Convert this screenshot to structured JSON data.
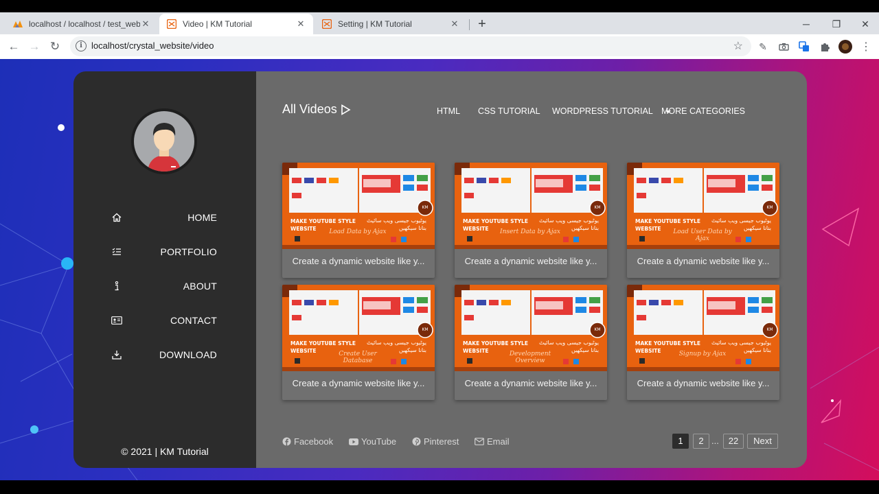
{
  "browser": {
    "tabs": [
      {
        "title": "localhost / localhost / test_web /",
        "active": false
      },
      {
        "title": "Video | KM Tutorial",
        "active": true
      },
      {
        "title": "Setting | KM Tutorial",
        "active": false
      }
    ],
    "url": "localhost/crystal_website/video",
    "new_tab_icon": "plus-icon"
  },
  "sidebar": {
    "menu": [
      {
        "label": "HOME",
        "icon": "home-icon"
      },
      {
        "label": "PORTFOLIO",
        "icon": "list-icon"
      },
      {
        "label": "ABOUT",
        "icon": "info-icon"
      },
      {
        "label": "CONTACT",
        "icon": "contact-card-icon"
      },
      {
        "label": "DOWNLOAD",
        "icon": "download-icon"
      }
    ],
    "copyright": "© 2021 | KM Tutorial"
  },
  "content": {
    "heading": "All Videos",
    "categories": [
      "HTML",
      "CSS TUTORIAL",
      "WORDPRESS TUTORIAL",
      "MORE CATEGORIES"
    ],
    "videos": [
      {
        "title": "Create a dynamic website like y...",
        "thumb_caption": "Load Data by Ajax"
      },
      {
        "title": "Create a dynamic website like y...",
        "thumb_caption": "Insert Data by Ajax"
      },
      {
        "title": "Create a dynamic website like y...",
        "thumb_caption": "Load User Data by Ajax"
      },
      {
        "title": "Create a dynamic website like y...",
        "thumb_caption": "Create User Database"
      },
      {
        "title": "Create a dynamic website like y...",
        "thumb_caption": "Development Overview"
      },
      {
        "title": "Create a dynamic website like y...",
        "thumb_caption": "Signup by Ajax"
      }
    ],
    "thumb_text": {
      "headline_1": "MAKE YOUTUBE STYLE",
      "headline_2": "WEBSITE",
      "urdu_1": "یوٹیوب جیسی ویب سائیٹ",
      "urdu_2": "بنانا سیکھیں",
      "badge": "KM"
    },
    "social": [
      {
        "label": "Facebook",
        "icon": "facebook-icon"
      },
      {
        "label": "YouTube",
        "icon": "youtube-icon"
      },
      {
        "label": "Pinterest",
        "icon": "pinterest-icon"
      },
      {
        "label": "Email",
        "icon": "email-icon"
      }
    ],
    "pagination": {
      "pages": [
        "1",
        "2",
        "22"
      ],
      "ellipsis": "...",
      "next": "Next",
      "current": "1"
    }
  },
  "colors": {
    "sidebar_bg": "#2c2c2c",
    "content_bg": "#6a6a6a",
    "thumb_orange": "#e8620f",
    "bg_gradient_left": "#1d2fb8",
    "bg_gradient_right": "#d40e5c"
  }
}
